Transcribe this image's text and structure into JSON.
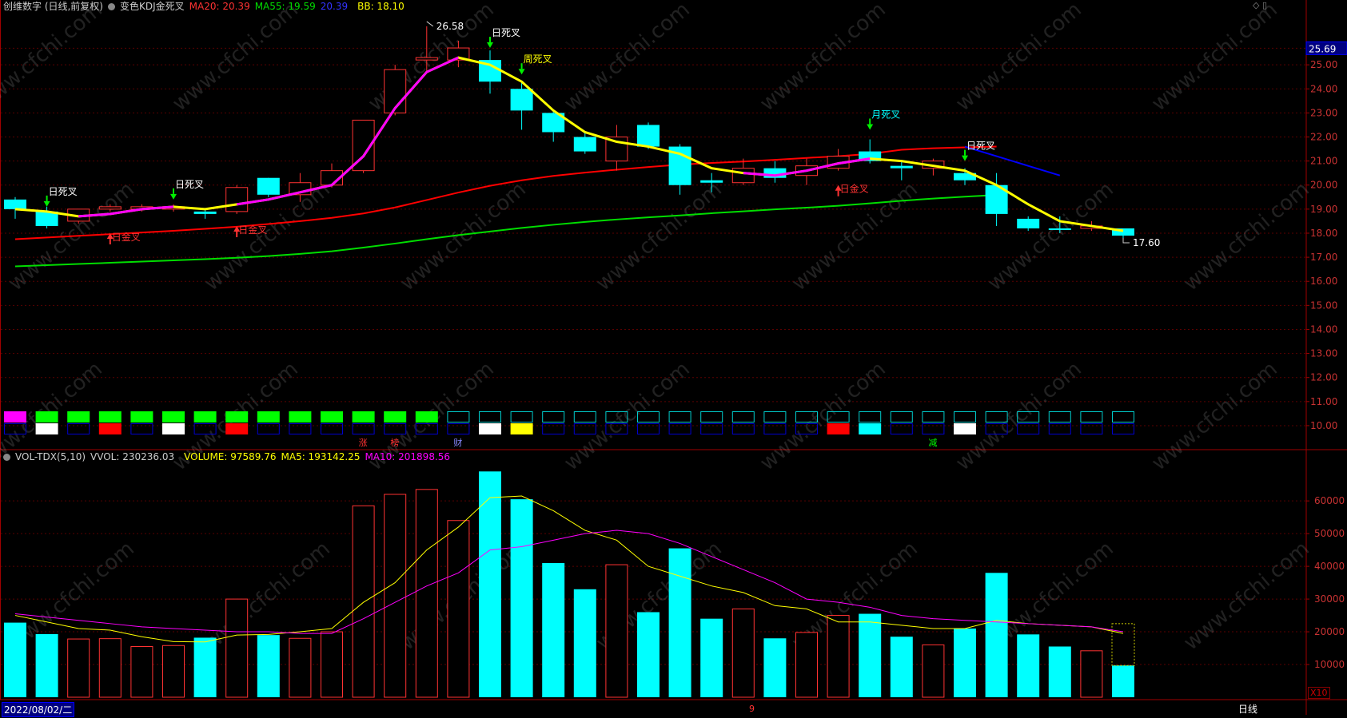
{
  "header": {
    "stock": "创维数字 (日线,前复权)",
    "indicator": "变色KDJ金死叉",
    "ma20": "MA20: 20.39",
    "ma55": "MA55: 19.59",
    "blue_val": "20.39",
    "bb": "BB: 18.10"
  },
  "vol_header": {
    "name": "VOL-TDX(5,10)",
    "vvol": "VVOL: 230236.03",
    "volume": "VOLUME: 97589.76",
    "ma5": "MA5: 193142.25",
    "ma10": "MA10: 201898.56"
  },
  "footer": {
    "date": "2022/08/02/二",
    "period": "日线",
    "x10": "X10",
    "marker": "9"
  },
  "colors": {
    "up": "#ff3232",
    "down": "#00ffff",
    "ma20": "#ff0000",
    "ma55": "#00dd00",
    "blue": "#0000ff",
    "yellow": "#ffff00",
    "magenta": "#ff00ff",
    "vol_ma5": "#ffff00",
    "vol_ma10": "#ff00ff"
  },
  "chart_data": [
    {
      "type": "candlestick",
      "ylim": [
        9.5,
        26.2
      ],
      "y_ticks": [
        "10.00",
        "11.00",
        "12.00",
        "13.00",
        "14.00",
        "15.00",
        "16.00",
        "17.00",
        "18.00",
        "19.00",
        "20.00",
        "21.00",
        "22.00",
        "23.00",
        "24.00",
        "25.00"
      ],
      "current_price_label": "25.69",
      "candles": [
        {
          "o": 19.0,
          "c": 19.4,
          "h": 19.5,
          "l": 18.6,
          "dir": "down"
        },
        {
          "o": 18.9,
          "c": 18.3,
          "h": 19.1,
          "l": 18.2,
          "dir": "down"
        },
        {
          "o": 18.5,
          "c": 19.0,
          "h": 19.0,
          "l": 18.4,
          "dir": "up"
        },
        {
          "o": 19.0,
          "c": 19.1,
          "h": 19.2,
          "l": 18.9,
          "dir": "up"
        },
        {
          "o": 19.0,
          "c": 19.1,
          "h": 19.2,
          "l": 18.9,
          "dir": "up"
        },
        {
          "o": 19.0,
          "c": 19.1,
          "h": 19.2,
          "l": 18.9,
          "dir": "up"
        },
        {
          "o": 18.9,
          "c": 18.8,
          "h": 19.0,
          "l": 18.6,
          "dir": "down"
        },
        {
          "o": 18.9,
          "c": 19.9,
          "h": 20.0,
          "l": 18.8,
          "dir": "up"
        },
        {
          "o": 20.3,
          "c": 19.6,
          "h": 20.3,
          "l": 19.5,
          "dir": "down"
        },
        {
          "o": 19.6,
          "c": 20.1,
          "h": 20.5,
          "l": 19.3,
          "dir": "up"
        },
        {
          "o": 20.0,
          "c": 20.6,
          "h": 20.9,
          "l": 19.9,
          "dir": "up"
        },
        {
          "o": 20.6,
          "c": 22.7,
          "h": 22.7,
          "l": 20.5,
          "dir": "up"
        },
        {
          "o": 23.0,
          "c": 24.8,
          "h": 25.0,
          "l": 22.9,
          "dir": "up"
        },
        {
          "o": 25.2,
          "c": 25.3,
          "h": 26.6,
          "l": 24.7,
          "dir": "up"
        },
        {
          "o": 25.2,
          "c": 25.7,
          "h": 26.0,
          "l": 24.9,
          "dir": "up"
        },
        {
          "o": 25.2,
          "c": 24.3,
          "h": 25.6,
          "l": 23.8,
          "dir": "down"
        },
        {
          "o": 24.0,
          "c": 23.1,
          "h": 24.3,
          "l": 22.3,
          "dir": "down"
        },
        {
          "o": 23.0,
          "c": 22.2,
          "h": 23.1,
          "l": 21.8,
          "dir": "down"
        },
        {
          "o": 22.0,
          "c": 21.4,
          "h": 22.2,
          "l": 21.3,
          "dir": "down"
        },
        {
          "o": 21.0,
          "c": 22.0,
          "h": 22.5,
          "l": 20.6,
          "dir": "up"
        },
        {
          "o": 22.5,
          "c": 21.6,
          "h": 22.6,
          "l": 21.5,
          "dir": "down"
        },
        {
          "o": 21.6,
          "c": 20.0,
          "h": 21.7,
          "l": 19.6,
          "dir": "down"
        },
        {
          "o": 20.2,
          "c": 20.1,
          "h": 20.5,
          "l": 19.7,
          "dir": "down"
        },
        {
          "o": 20.1,
          "c": 20.7,
          "h": 21.1,
          "l": 20.0,
          "dir": "up"
        },
        {
          "o": 20.7,
          "c": 20.3,
          "h": 21.0,
          "l": 20.1,
          "dir": "down"
        },
        {
          "o": 20.4,
          "c": 20.8,
          "h": 21.1,
          "l": 20.0,
          "dir": "up"
        },
        {
          "o": 20.7,
          "c": 21.2,
          "h": 21.5,
          "l": 20.6,
          "dir": "up"
        },
        {
          "o": 21.4,
          "c": 21.0,
          "h": 21.9,
          "l": 20.9,
          "dir": "down"
        },
        {
          "o": 20.8,
          "c": 20.7,
          "h": 21.0,
          "l": 20.2,
          "dir": "down"
        },
        {
          "o": 20.7,
          "c": 21.0,
          "h": 21.1,
          "l": 20.4,
          "dir": "up"
        },
        {
          "o": 20.5,
          "c": 20.2,
          "h": 20.7,
          "l": 20.0,
          "dir": "down"
        },
        {
          "o": 20.0,
          "c": 18.8,
          "h": 20.5,
          "l": 18.3,
          "dir": "down"
        },
        {
          "o": 18.6,
          "c": 18.2,
          "h": 18.7,
          "l": 18.1,
          "dir": "down"
        },
        {
          "o": 18.2,
          "c": 18.2,
          "h": 18.7,
          "l": 18.0,
          "dir": "down"
        },
        {
          "o": 18.2,
          "c": 18.3,
          "h": 18.5,
          "l": 18.1,
          "dir": "up"
        },
        {
          "o": 18.2,
          "c": 17.9,
          "h": 18.2,
          "l": 17.6,
          "dir": "down"
        }
      ],
      "ma20": [
        17.75,
        17.82,
        17.89,
        17.96,
        18.03,
        18.1,
        18.18,
        18.27,
        18.38,
        18.5,
        18.64,
        18.82,
        19.07,
        19.38,
        19.69,
        19.97,
        20.2,
        20.38,
        20.52,
        20.64,
        20.75,
        20.85,
        20.92,
        20.98,
        21.05,
        21.13,
        21.2,
        21.3,
        21.47,
        21.53,
        21.57,
        21.6
      ],
      "ma55": [
        16.62,
        16.67,
        16.72,
        16.77,
        16.82,
        16.87,
        16.92,
        16.98,
        17.05,
        17.14,
        17.25,
        17.4,
        17.57,
        17.75,
        17.92,
        18.07,
        18.22,
        18.35,
        18.47,
        18.57,
        18.66,
        18.74,
        18.83,
        18.91,
        18.99,
        19.06,
        19.14,
        19.24,
        19.35,
        19.44,
        19.52,
        19.59
      ],
      "blue": [
        21.6,
        21.2,
        20.8,
        20.4
      ],
      "bb": [
        19.0,
        18.9,
        18.7,
        18.8,
        19.0,
        19.1,
        19.0,
        19.2,
        19.4,
        19.7,
        20.0,
        21.2,
        23.2,
        24.7,
        25.3,
        25.0,
        24.3,
        23.1,
        22.2,
        21.8,
        21.6,
        21.3,
        20.7,
        20.5,
        20.4,
        20.6,
        20.9,
        21.1,
        21.0,
        20.8,
        20.6,
        20.0,
        19.2,
        18.5,
        18.3,
        18.1
      ],
      "bb_magenta_ranges": [
        [
          2,
          5
        ],
        [
          7,
          14
        ],
        [
          23,
          27
        ]
      ],
      "annotations": [
        {
          "i": 1,
          "text": "日死叉",
          "type": "death",
          "price": 19.1,
          "color": "#ffffff"
        },
        {
          "i": 3,
          "text": "日金叉",
          "type": "golden",
          "price": 18.0,
          "color": "#ff3232"
        },
        {
          "i": 5,
          "text": "日死叉",
          "type": "death",
          "price": 19.4,
          "color": "#ffffff"
        },
        {
          "i": 7,
          "text": "日金叉",
          "type": "golden",
          "price": 18.3,
          "color": "#ff3232"
        },
        {
          "i": 15,
          "text": "日死叉",
          "type": "death",
          "price": 25.7,
          "color": "#ffffff"
        },
        {
          "i": 16,
          "text": "周死叉",
          "type": "death",
          "price": 24.6,
          "color": "#ffff00"
        },
        {
          "i": 26,
          "text": "日金叉",
          "type": "golden",
          "price": 20.0,
          "color": "#ff3232"
        },
        {
          "i": 27,
          "text": "月死叉",
          "type": "death",
          "price": 22.3,
          "color": "#00ffff"
        },
        {
          "i": 30,
          "text": "日死叉",
          "type": "death",
          "price": 21.0,
          "color": "#ffffff"
        }
      ],
      "high_label": {
        "i": 13,
        "text": "26.58"
      },
      "low_label": {
        "i": 35,
        "text": "17.60"
      },
      "row1_colors": [
        "magenta",
        "green",
        "green",
        "green",
        "green",
        "green",
        "green",
        "green",
        "green",
        "green",
        "green",
        "green",
        "green",
        "green",
        "box",
        "box",
        "box",
        "box",
        "box",
        "box",
        "box",
        "box",
        "box",
        "box",
        "box",
        "box",
        "box",
        "box",
        "box",
        "box",
        "box",
        "box",
        "box",
        "box",
        "box",
        "box"
      ],
      "row2_colors": [
        "box",
        "white",
        "box",
        "red",
        "box",
        "white",
        "box",
        "red",
        "box",
        "box",
        "box",
        "box",
        "box",
        "box",
        "box",
        "white",
        "yellow",
        "box",
        "box",
        "box",
        "box",
        "box",
        "box",
        "box",
        "box",
        "box",
        "red",
        "cyan",
        "box",
        "box",
        "white",
        "box",
        "box",
        "box",
        "box",
        "box"
      ],
      "events": [
        {
          "i": 11,
          "text": "涨",
          "color": "#ff3232"
        },
        {
          "i": 12,
          "text": "榜",
          "color": "#ff3232"
        },
        {
          "i": 14,
          "text": "财",
          "color": "#8888ff"
        },
        {
          "i": 29,
          "text": "减",
          "color": "#00ff00"
        }
      ]
    },
    {
      "type": "bar",
      "ylim": [
        0,
        72000
      ],
      "y_ticks": [
        "10000",
        "20000",
        "30000",
        "40000",
        "50000",
        "60000"
      ],
      "volume": [
        22800,
        19300,
        17800,
        17900,
        15500,
        15800,
        18200,
        30000,
        19000,
        18000,
        20000,
        58500,
        62000,
        63500,
        54000,
        69000,
        60500,
        41000,
        33000,
        40500,
        26000,
        45500,
        24000,
        27000,
        18000,
        19800,
        25000,
        25500,
        18500,
        16000,
        21000,
        38000,
        19200,
        15500,
        14200,
        9700
      ],
      "dir": [
        "down",
        "down",
        "up",
        "up",
        "up",
        "up",
        "down",
        "up",
        "down",
        "up",
        "up",
        "up",
        "up",
        "up",
        "up",
        "down",
        "down",
        "down",
        "down",
        "up",
        "down",
        "down",
        "down",
        "up",
        "down",
        "up",
        "up",
        "down",
        "down",
        "up",
        "down",
        "down",
        "down",
        "down",
        "up",
        "down"
      ],
      "ma5": [
        25000,
        23000,
        21000,
        20500,
        18500,
        17000,
        16900,
        19000,
        19200,
        20000,
        21000,
        29000,
        35000,
        45000,
        52000,
        61000,
        61500,
        57000,
        51000,
        48000,
        40000,
        37000,
        34000,
        32000,
        28000,
        27000,
        23000,
        23000,
        22000,
        21000,
        21000,
        23500,
        22500,
        22000,
        21500,
        19500
      ],
      "ma10": [
        25500,
        24500,
        23500,
        22500,
        21500,
        21000,
        20500,
        20000,
        20000,
        19500,
        19500,
        24000,
        29000,
        34000,
        38000,
        45000,
        46000,
        48000,
        50000,
        51000,
        50000,
        47000,
        43000,
        39000,
        35000,
        30000,
        29000,
        27500,
        25000,
        24000,
        23500,
        23000,
        22500,
        22000,
        21500,
        20000
      ]
    }
  ]
}
